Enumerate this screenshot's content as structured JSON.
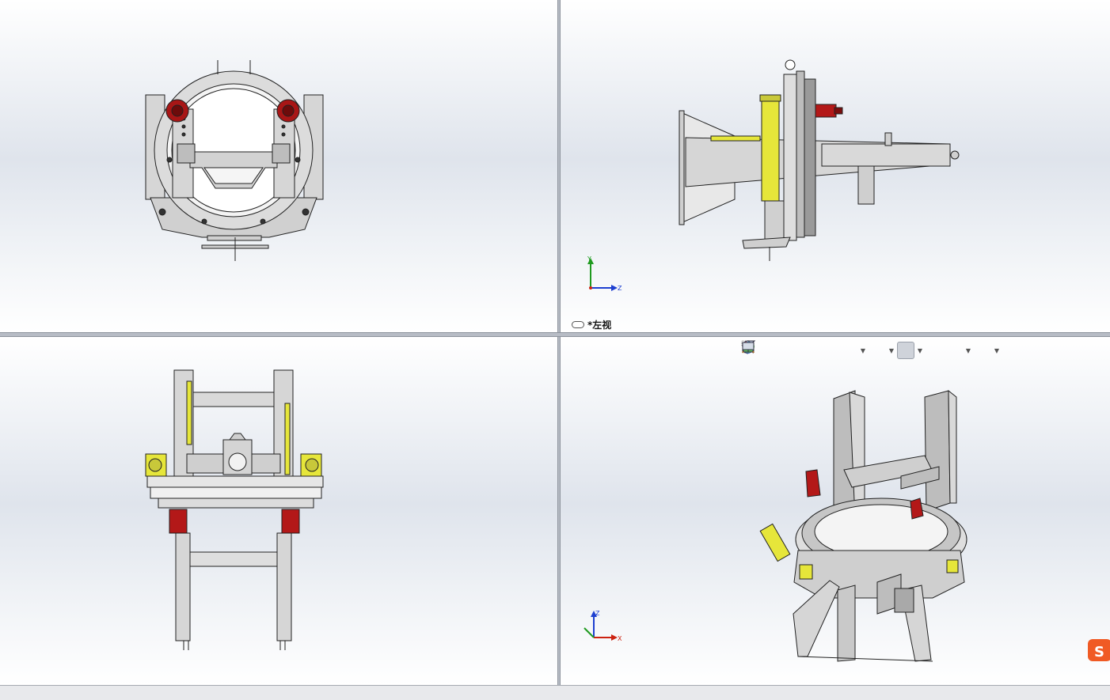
{
  "viewports": {
    "top_left": {
      "name": "front-view"
    },
    "top_right": {
      "name": "left-view",
      "label": "*左视"
    },
    "bottom_left": {
      "name": "top-view"
    },
    "bottom_right": {
      "name": "isometric-view"
    }
  },
  "triad": {
    "left": {
      "up": "Y",
      "right": "Z"
    },
    "iso": {
      "up": "Z",
      "right": "X"
    }
  },
  "hud_toolbar": {
    "buttons": [
      "zoom-to-fit",
      "zoom-to-area",
      "previous-view",
      "section-view",
      "dynamic-annotation",
      "view-orientation",
      "display-style",
      "hide-show-items",
      "edit-appearance",
      "apply-scene",
      "view-settings"
    ]
  },
  "colors": {
    "accent_yellow": "#e8e83a",
    "accent_red": "#b01818",
    "metal": "#d8d8d8",
    "line": "#222222"
  }
}
